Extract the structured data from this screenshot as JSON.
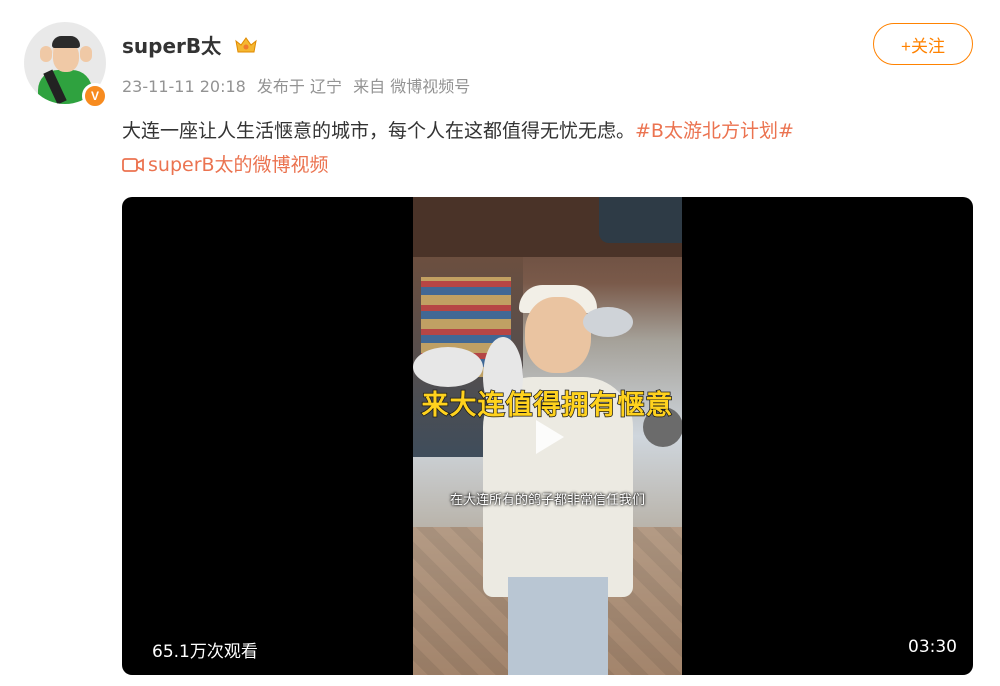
{
  "post": {
    "username": "superB太",
    "date": "23-11-11 20:18",
    "posted_from": "发布于 辽宁",
    "source": "来自 微博视频号",
    "follow_label": "+关注",
    "verified_badge": "V",
    "text": "大连一座让人生活惬意的城市，每个人在这都值得无忧无虑。",
    "hashtag": "#B太游北方计划#",
    "video_link_label": "superB太的微博视频"
  },
  "video": {
    "caption_big": "来大连值得拥有惬意",
    "caption_sub": "在大连所有的鸽子都非常信任我们",
    "views": "65.1万次观看",
    "duration": "03:30"
  },
  "colors": {
    "accent": "#ff8200",
    "link": "#eb7350",
    "meta": "#939393",
    "caption_yellow": "#ffd21e"
  }
}
